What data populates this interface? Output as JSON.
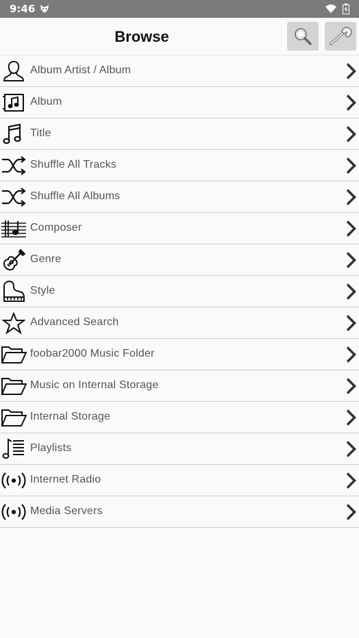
{
  "status_bar": {
    "time": "9:46"
  },
  "header": {
    "title": "Browse"
  },
  "menu": [
    {
      "label": "Album Artist / Album",
      "icon": "person-icon"
    },
    {
      "label": "Album",
      "icon": "album-icon"
    },
    {
      "label": "Title",
      "icon": "music-note-icon"
    },
    {
      "label": "Shuffle All Tracks",
      "icon": "shuffle-icon"
    },
    {
      "label": "Shuffle All Albums",
      "icon": "shuffle-icon"
    },
    {
      "label": "Composer",
      "icon": "staff-icon"
    },
    {
      "label": "Genre",
      "icon": "guitar-icon"
    },
    {
      "label": "Style",
      "icon": "piano-icon"
    },
    {
      "label": "Advanced Search",
      "icon": "star-icon"
    },
    {
      "label": "foobar2000 Music Folder",
      "icon": "folder-icon"
    },
    {
      "label": "Music on Internal Storage",
      "icon": "folder-icon"
    },
    {
      "label": "Internal Storage",
      "icon": "folder-icon"
    },
    {
      "label": "Playlists",
      "icon": "playlist-icon"
    },
    {
      "label": "Internet Radio",
      "icon": "radio-icon"
    },
    {
      "label": "Media Servers",
      "icon": "radio-icon"
    }
  ]
}
